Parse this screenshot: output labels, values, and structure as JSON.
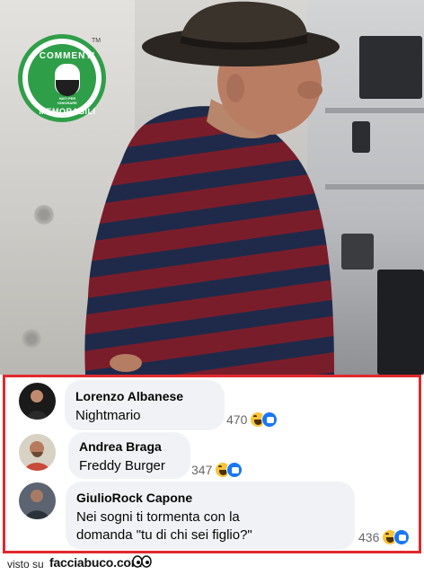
{
  "logo": {
    "top_text": "COMMENTI",
    "bottom_text": "MEMORABILI",
    "tagline": "NATI PER IGNORARE",
    "trademark": "TM"
  },
  "photo": {
    "icon": "photo-of-elderly-man-in-striped-sweater"
  },
  "comments": [
    {
      "author": "Lorenzo Albanese",
      "text": "Nightmario",
      "count": "470",
      "reactions": [
        "haha",
        "like"
      ]
    },
    {
      "author": "Andrea Braga",
      "text": "Freddy Burger",
      "count": "347",
      "reactions": [
        "haha",
        "like"
      ]
    },
    {
      "author": "GiulioRock Capone",
      "text_line1": "Nei sogni ti tormenta con la",
      "text_line2": "domanda \"tu di chi sei figlio?\"",
      "count": "436",
      "reactions": [
        "haha",
        "like"
      ]
    }
  ],
  "footer": {
    "prefix": "visto su",
    "site": "facciabuco.com"
  },
  "colors": {
    "frame": "#e0292d",
    "bubble": "#f0f2f5",
    "logo_green": "#2f9e48",
    "haha": "#f7c33b",
    "like": "#1877f2"
  }
}
